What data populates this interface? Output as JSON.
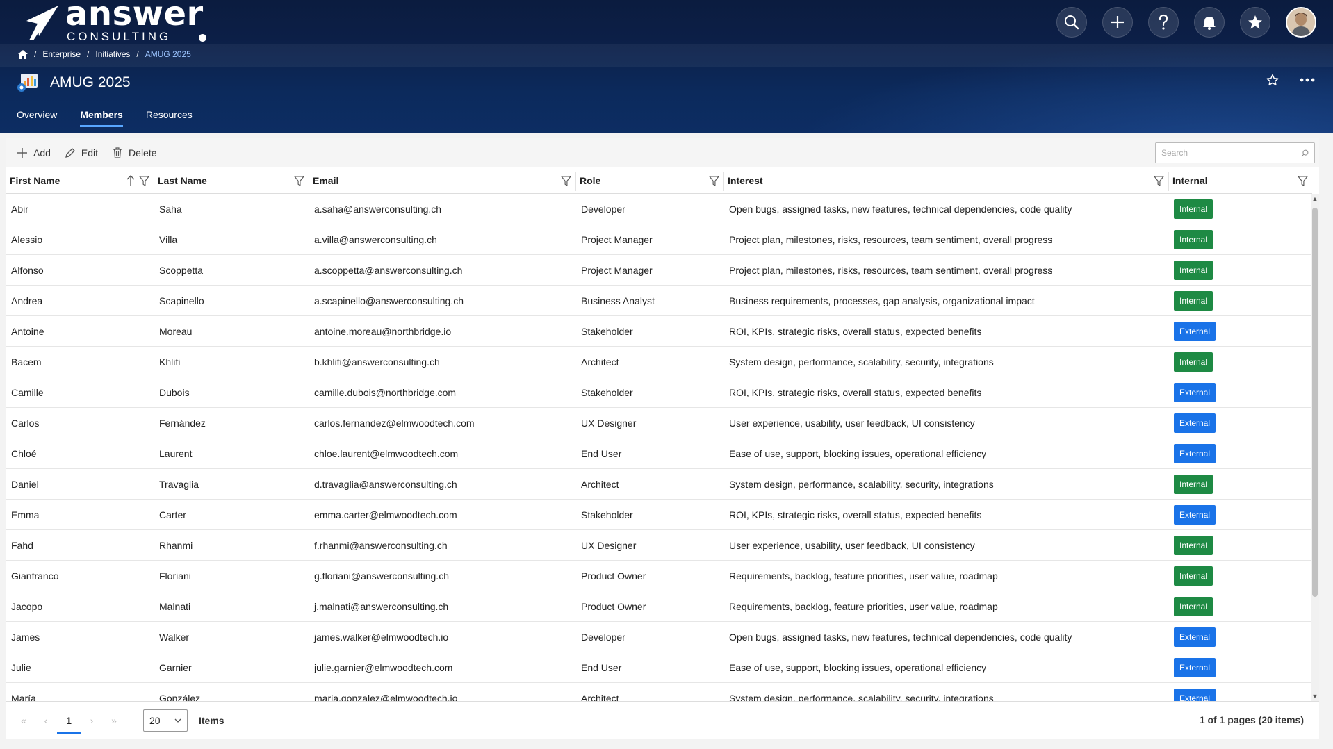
{
  "brand": {
    "name": "answer",
    "sub": "CONSULTING"
  },
  "top_actions": [
    {
      "name": "search-icon"
    },
    {
      "name": "plus-icon"
    },
    {
      "name": "help-icon"
    },
    {
      "name": "bell-icon"
    },
    {
      "name": "star-icon"
    }
  ],
  "breadcrumb": {
    "items": [
      "Enterprise",
      "Initiatives"
    ],
    "current": "AMUG 2025",
    "sep": "/"
  },
  "page": {
    "title": "AMUG 2025"
  },
  "tabs": [
    {
      "label": "Overview",
      "active": false
    },
    {
      "label": "Members",
      "active": true
    },
    {
      "label": "Resources",
      "active": false
    }
  ],
  "toolbar": {
    "add_label": "Add",
    "edit_label": "Edit",
    "delete_label": "Delete",
    "search_placeholder": "Search"
  },
  "columns": [
    "First Name",
    "Last Name",
    "Email",
    "Role",
    "Interest",
    "Internal"
  ],
  "rows": [
    {
      "first": "Abir",
      "last": "Saha",
      "email": "a.saha@answerconsulting.ch",
      "role": "Developer",
      "interest": "Open bugs, assigned tasks, new features, technical dependencies, code quality",
      "internal": "Internal"
    },
    {
      "first": "Alessio",
      "last": "Villa",
      "email": "a.villa@answerconsulting.ch",
      "role": "Project Manager",
      "interest": "Project plan, milestones, risks, resources, team sentiment, overall progress",
      "internal": "Internal"
    },
    {
      "first": "Alfonso",
      "last": "Scoppetta",
      "email": "a.scoppetta@answerconsulting.ch",
      "role": "Project Manager",
      "interest": "Project plan, milestones, risks, resources, team sentiment, overall progress",
      "internal": "Internal"
    },
    {
      "first": "Andrea",
      "last": "Scapinello",
      "email": "a.scapinello@answerconsulting.ch",
      "role": "Business Analyst",
      "interest": "Business requirements, processes, gap analysis, organizational impact",
      "internal": "Internal"
    },
    {
      "first": "Antoine",
      "last": "Moreau",
      "email": "antoine.moreau@northbridge.io",
      "role": "Stakeholder",
      "interest": "ROI, KPIs, strategic risks, overall status, expected benefits",
      "internal": "External"
    },
    {
      "first": "Bacem",
      "last": "Khlifi",
      "email": "b.khlifi@answerconsulting.ch",
      "role": "Architect",
      "interest": "System design, performance, scalability, security, integrations",
      "internal": "Internal"
    },
    {
      "first": "Camille",
      "last": "Dubois",
      "email": "camille.dubois@northbridge.com",
      "role": "Stakeholder",
      "interest": "ROI, KPIs, strategic risks, overall status, expected benefits",
      "internal": "External"
    },
    {
      "first": "Carlos",
      "last": "Fernández",
      "email": "carlos.fernandez@elmwoodtech.com",
      "role": "UX Designer",
      "interest": "User experience, usability, user feedback, UI consistency",
      "internal": "External"
    },
    {
      "first": "Chloé",
      "last": "Laurent",
      "email": "chloe.laurent@elmwoodtech.com",
      "role": "End User",
      "interest": "Ease of use, support, blocking issues, operational efficiency",
      "internal": "External"
    },
    {
      "first": "Daniel",
      "last": "Travaglia",
      "email": "d.travaglia@answerconsulting.ch",
      "role": "Architect",
      "interest": "System design, performance, scalability, security, integrations",
      "internal": "Internal"
    },
    {
      "first": "Emma",
      "last": "Carter",
      "email": "emma.carter@elmwoodtech.com",
      "role": "Stakeholder",
      "interest": "ROI, KPIs, strategic risks, overall status, expected benefits",
      "internal": "External"
    },
    {
      "first": "Fahd",
      "last": "Rhanmi",
      "email": "f.rhanmi@answerconsulting.ch",
      "role": "UX Designer",
      "interest": "User experience, usability, user feedback, UI consistency",
      "internal": "Internal"
    },
    {
      "first": "Gianfranco",
      "last": "Floriani",
      "email": "g.floriani@answerconsulting.ch",
      "role": "Product Owner",
      "interest": "Requirements, backlog, feature priorities, user value, roadmap",
      "internal": "Internal"
    },
    {
      "first": "Jacopo",
      "last": "Malnati",
      "email": "j.malnati@answerconsulting.ch",
      "role": "Product Owner",
      "interest": "Requirements, backlog, feature priorities, user value, roadmap",
      "internal": "Internal"
    },
    {
      "first": "James",
      "last": "Walker",
      "email": "james.walker@elmwoodtech.io",
      "role": "Developer",
      "interest": "Open bugs, assigned tasks, new features, technical dependencies, code quality",
      "internal": "External"
    },
    {
      "first": "Julie",
      "last": "Garnier",
      "email": "julie.garnier@elmwoodtech.com",
      "role": "End User",
      "interest": "Ease of use, support, blocking issues, operational efficiency",
      "internal": "External"
    },
    {
      "first": "María",
      "last": "González",
      "email": "maria.gonzalez@elmwoodtech.io",
      "role": "Architect",
      "interest": "System design, performance, scalability, security, integrations",
      "internal": "External"
    }
  ],
  "pager": {
    "current_page": "1",
    "page_size": "20",
    "items_label": "Items",
    "info": "1 of 1 pages (20 items)"
  },
  "colors": {
    "internal": "#1e8a44",
    "external": "#1a73e8",
    "accent": "#58a6ff"
  }
}
